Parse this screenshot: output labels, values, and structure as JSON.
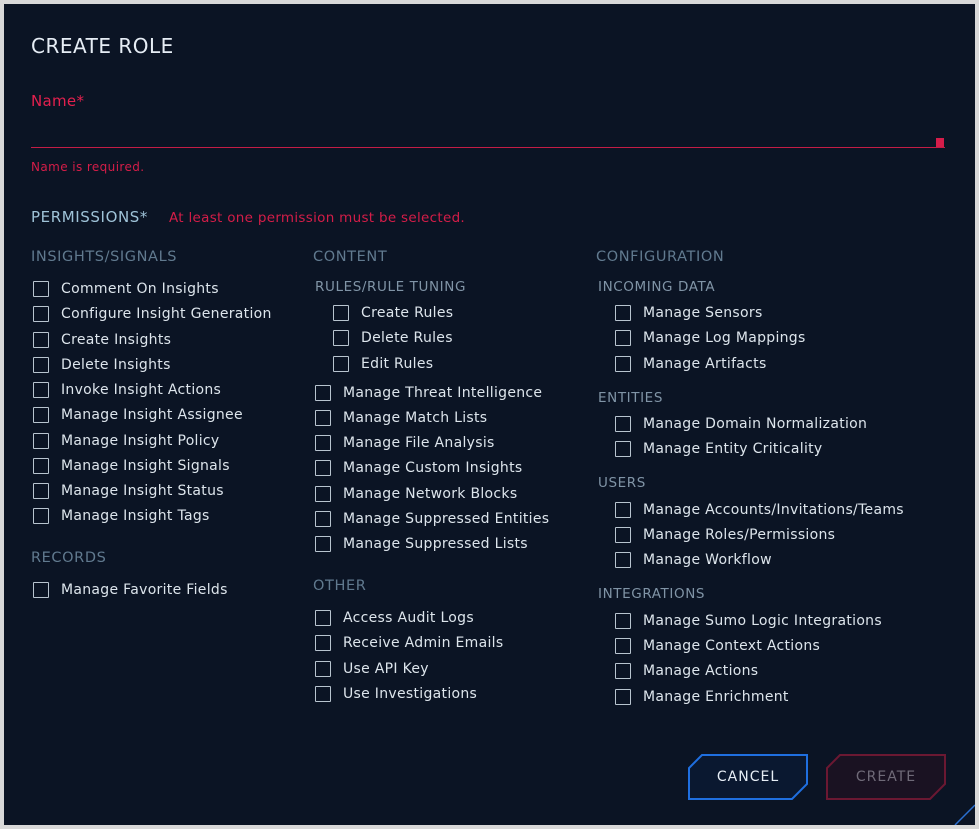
{
  "dialog": {
    "title": "CREATE ROLE",
    "name_label": "Name*",
    "name_value": "",
    "name_error": "Name is required.",
    "permissions_label": "PERMISSIONS*",
    "permissions_error": "At least one permission must be selected.",
    "cancel_label": "CANCEL",
    "create_label": "CREATE"
  },
  "colors": {
    "background": "#0b1424",
    "error": "#e3204e",
    "accent": "#1f6fe0",
    "section": "#617a8f"
  },
  "col1": {
    "insights_title": "INSIGHTS/SIGNALS",
    "insights": [
      "Comment On Insights",
      "Configure Insight Generation",
      "Create Insights",
      "Delete Insights",
      "Invoke Insight Actions",
      "Manage Insight Assignee",
      "Manage Insight Policy",
      "Manage Insight Signals",
      "Manage Insight Status",
      "Manage Insight Tags"
    ],
    "records_title": "RECORDS",
    "records": [
      "Manage Favorite Fields"
    ]
  },
  "col2": {
    "content_title": "CONTENT",
    "rules_title": "RULES/RULE TUNING",
    "rules": [
      "Create Rules",
      "Delete Rules",
      "Edit Rules"
    ],
    "content": [
      "Manage Threat Intelligence",
      "Manage Match Lists",
      "Manage File Analysis",
      "Manage Custom Insights",
      "Manage Network Blocks",
      "Manage Suppressed Entities",
      "Manage Suppressed Lists"
    ],
    "other_title": "OTHER",
    "other": [
      "Access Audit Logs",
      "Receive Admin Emails",
      "Use API Key",
      "Use Investigations"
    ]
  },
  "col3": {
    "config_title": "CONFIGURATION",
    "incoming_title": "INCOMING DATA",
    "incoming": [
      "Manage Sensors",
      "Manage Log Mappings",
      "Manage Artifacts"
    ],
    "entities_title": "ENTITIES",
    "entities": [
      "Manage Domain Normalization",
      "Manage Entity Criticality"
    ],
    "users_title": "USERS",
    "users": [
      "Manage Accounts/Invitations/Teams",
      "Manage Roles/Permissions",
      "Manage Workflow"
    ],
    "integrations_title": "INTEGRATIONS",
    "integrations": [
      "Manage Sumo Logic Integrations",
      "Manage Context Actions",
      "Manage Actions",
      "Manage Enrichment"
    ]
  }
}
